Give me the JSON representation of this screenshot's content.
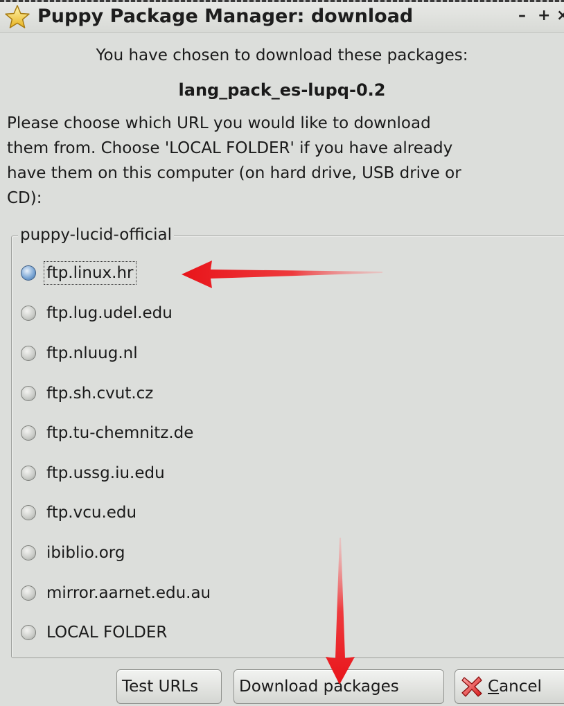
{
  "window": {
    "title": "Puppy Package Manager: download",
    "controls": {
      "minimize": "–",
      "maximize": "+",
      "close": "×"
    }
  },
  "dialog": {
    "intro": "You have chosen to download these packages:",
    "package_name": "lang_pack_es-lupq-0.2",
    "instructions": "Please choose which URL you would like to download\nthem from. Choose 'LOCAL FOLDER' if you have already\nhave them on this computer (on hard drive, USB drive or\nCD):"
  },
  "mirror_group": {
    "label": "puppy-lucid-official",
    "selected": "ftp.linux.hr",
    "options": [
      {
        "label": "ftp.linux.hr",
        "checked": true
      },
      {
        "label": "ftp.lug.udel.edu",
        "checked": false
      },
      {
        "label": "ftp.nluug.nl",
        "checked": false
      },
      {
        "label": "ftp.sh.cvut.cz",
        "checked": false
      },
      {
        "label": "ftp.tu-chemnitz.de",
        "checked": false
      },
      {
        "label": "ftp.ussg.iu.edu",
        "checked": false
      },
      {
        "label": "ftp.vcu.edu",
        "checked": false
      },
      {
        "label": "ibiblio.org",
        "checked": false
      },
      {
        "label": "mirror.aarnet.edu.au",
        "checked": false
      },
      {
        "label": "LOCAL FOLDER",
        "checked": false
      }
    ]
  },
  "buttons": {
    "test_urls": "Test URLs",
    "download_packages": "Download packages",
    "cancel_mnemonic": "C",
    "cancel_rest": "ancel"
  },
  "icons": {
    "title": "star-icon",
    "cancel": "cancel-x-icon",
    "annotation": "red-arrow-icon"
  },
  "colors": {
    "window_bg": "#dcdedb",
    "radio_checked": "#5b8cc4",
    "arrow": "#e8141a"
  }
}
